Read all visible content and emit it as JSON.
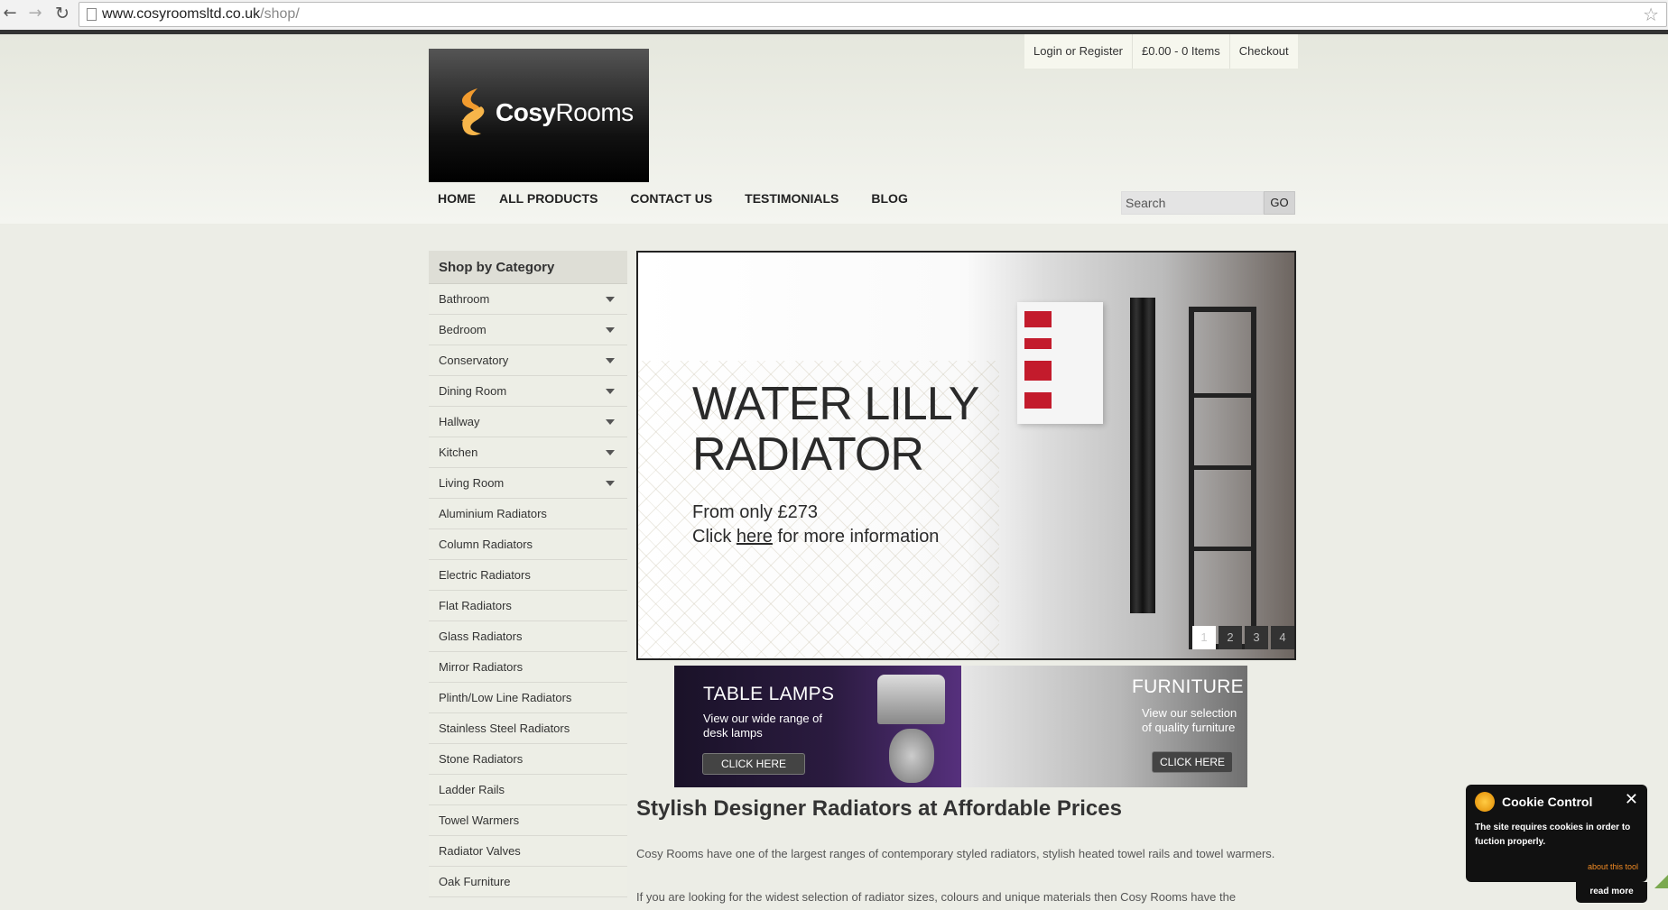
{
  "browser": {
    "url_host": "www.cosyroomsltd.co.uk",
    "url_path": "/shop/"
  },
  "header": {
    "logo_brand_bold": "Cosy",
    "logo_brand_light": "Rooms",
    "top_links": [
      "Login or Register",
      "£0.00 - 0 Items",
      "Checkout"
    ],
    "nav": [
      "HOME",
      "ALL PRODUCTS",
      "CONTACT US",
      "TESTIMONIALS",
      "BLOG"
    ],
    "search_placeholder": "Search",
    "search_button": "GO"
  },
  "sidebar": {
    "title": "Shop by Category",
    "categories": [
      {
        "label": "Bathroom",
        "expandable": true
      },
      {
        "label": "Bedroom",
        "expandable": true
      },
      {
        "label": "Conservatory",
        "expandable": true
      },
      {
        "label": "Dining Room",
        "expandable": true
      },
      {
        "label": "Hallway",
        "expandable": true
      },
      {
        "label": "Kitchen",
        "expandable": true
      },
      {
        "label": "Living Room",
        "expandable": true
      },
      {
        "label": "Aluminium Radiators",
        "expandable": false
      },
      {
        "label": "Column Radiators",
        "expandable": false
      },
      {
        "label": "Electric Radiators",
        "expandable": false
      },
      {
        "label": "Flat Radiators",
        "expandable": false
      },
      {
        "label": "Glass Radiators",
        "expandable": false
      },
      {
        "label": "Mirror Radiators",
        "expandable": false
      },
      {
        "label": "Plinth/Low Line Radiators",
        "expandable": false
      },
      {
        "label": "Stainless Steel Radiators",
        "expandable": false
      },
      {
        "label": "Stone Radiators",
        "expandable": false
      },
      {
        "label": "Ladder Rails",
        "expandable": false
      },
      {
        "label": "Towel Warmers",
        "expandable": false
      },
      {
        "label": "Radiator Valves",
        "expandable": false
      },
      {
        "label": "Oak Furniture",
        "expandable": false
      }
    ]
  },
  "banner": {
    "title_line1": "WATER LILLY",
    "title_line2": "RADIATOR",
    "price_line": "From only £273",
    "click_prefix": "Click ",
    "click_link": "here",
    "click_suffix": " for more information",
    "slides": [
      "1",
      "2",
      "3",
      "4"
    ],
    "active_slide": 0
  },
  "promos": {
    "lamps": {
      "heading": "TABLE LAMPS",
      "text_line1": "View our wide range of",
      "text_line2": "desk lamps",
      "button": "CLICK HERE"
    },
    "furniture": {
      "heading": "FURNITURE",
      "text_line1": "View our selection",
      "text_line2": "of quality furniture",
      "button": "CLICK HERE"
    }
  },
  "content": {
    "heading": "Stylish Designer Radiators at Affordable Prices",
    "para1": "Cosy Rooms have one of the largest ranges of contemporary styled radiators, stylish heated towel rails and towel warmers.",
    "para2": "If you are looking for the widest selection of radiator sizes, colours and unique materials then Cosy Rooms have the"
  },
  "cookie": {
    "title": "Cookie Control",
    "close": "✕",
    "text": "The site requires cookies in order to fuction properly.",
    "about": "about this tool",
    "read_more": "read more"
  }
}
